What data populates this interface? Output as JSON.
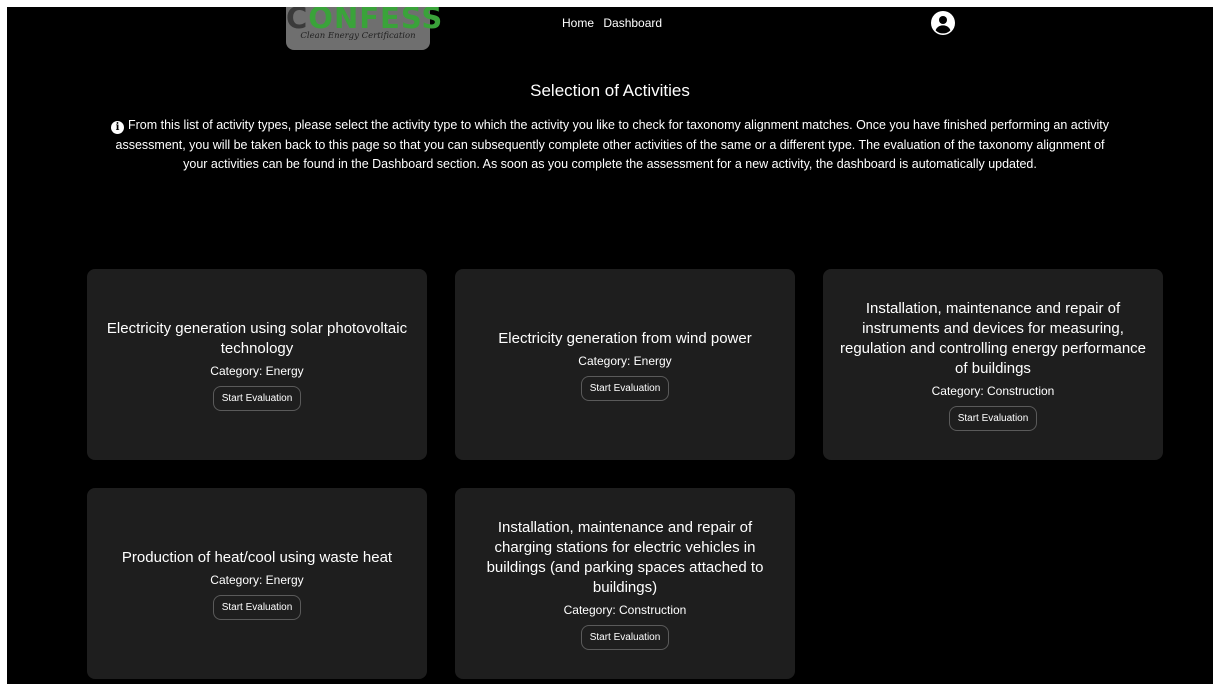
{
  "header": {
    "logo": {
      "text_c": "C",
      "text_onfess": "ONFESS",
      "tagline": "Clean Energy Certification"
    },
    "nav": [
      {
        "label": "Home"
      },
      {
        "label": "Dashboard"
      }
    ],
    "user_icon": "account-circle-icon"
  },
  "main": {
    "title": "Selection of Activities",
    "info_icon": "info-icon",
    "intro": "From this list of activity types, please select the activity type to which the activity you like to check for taxonomy alignment matches. Once you have finished performing an activity assessment, you will be taken back to this page so that you can subsequently complete other activities of the same or a different type. The evaluation of the taxonomy alignment of your activities can be found in the Dashboard section. As soon as you complete the assessment for a new activity, the dashboard is automatically updated.",
    "cards": [
      {
        "title": "Electricity generation using solar photovoltaic technology",
        "category": "Category: Energy",
        "button": "Start Evaluation"
      },
      {
        "title": "Electricity generation from wind power",
        "category": "Category: Energy",
        "button": "Start Evaluation"
      },
      {
        "title": "Installation, maintenance and repair of instruments and devices for measuring, regulation and controlling energy performance of buildings",
        "category": "Category: Construction",
        "button": "Start Evaluation"
      },
      {
        "title": "Production of heat/cool using waste heat",
        "category": "Category: Energy",
        "button": "Start Evaluation"
      },
      {
        "title": "Installation, maintenance and repair of charging stations for electric vehicles in buildings (and parking spaces attached to buildings)",
        "category": "Category: Construction",
        "button": "Start Evaluation"
      }
    ]
  },
  "colors": {
    "background": "#000000",
    "card": "#1e1e1e",
    "text": "#ffffff",
    "logo_green": "#3aa33a"
  }
}
